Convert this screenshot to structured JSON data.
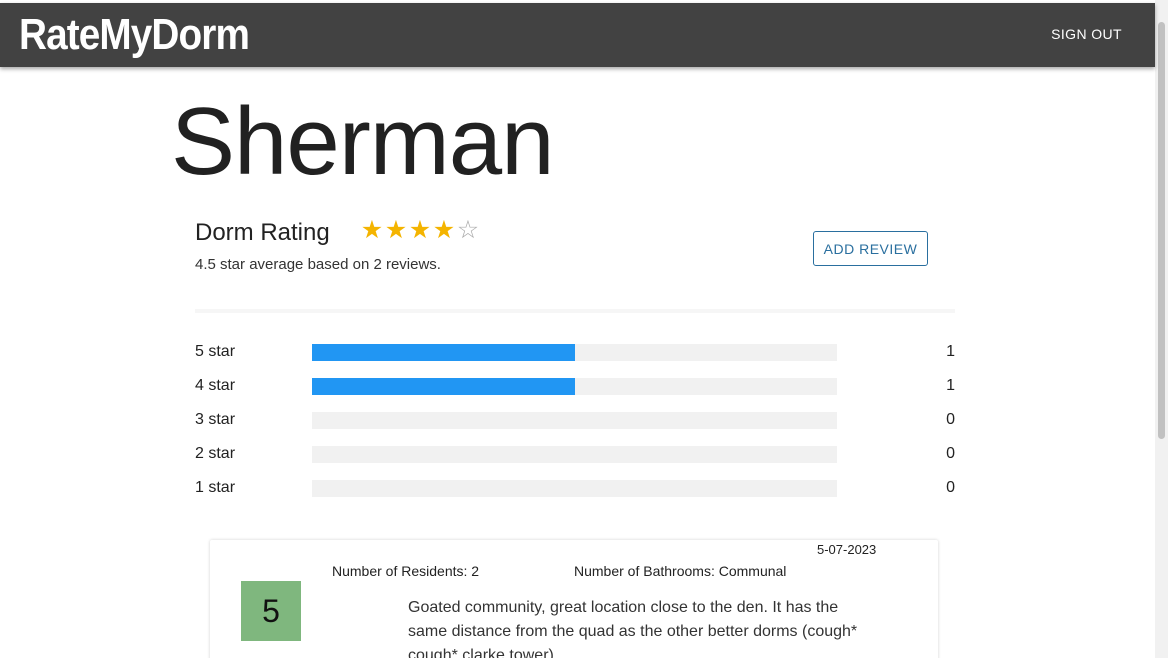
{
  "app": {
    "brand": "RateMyDorm",
    "sign_out_label": "SIGN OUT"
  },
  "colors": {
    "appbar": "#424242",
    "bar_fill": "#2196f3",
    "bar_track": "#f1f1f1",
    "star_filled": "#f4b400",
    "score_badge": "#7fb77e",
    "button_accent": "#2a6f9f"
  },
  "dorm": {
    "name": "Sherman"
  },
  "rating": {
    "heading": "Dorm Rating",
    "stars_filled": 4,
    "stars_total": 5,
    "average_text": "4.5 star average based on 2 reviews.",
    "add_review_label": "ADD REVIEW"
  },
  "distribution": [
    {
      "label": "5 star",
      "count": "1",
      "fraction": 0.5
    },
    {
      "label": "4 star",
      "count": "1",
      "fraction": 0.5
    },
    {
      "label": "3 star",
      "count": "0",
      "fraction": 0
    },
    {
      "label": "2 star",
      "count": "0",
      "fraction": 0
    },
    {
      "label": "1 star",
      "count": "0",
      "fraction": 0
    }
  ],
  "reviews": [
    {
      "date": "5-07-2023",
      "residents": "Number of Residents: 2",
      "bathrooms": "Number of Bathrooms: Communal",
      "score": "5",
      "text": "Goated community, great location close to the den. It has the same distance from the quad as the other better dorms (cough* cough* clarke tower)"
    }
  ]
}
